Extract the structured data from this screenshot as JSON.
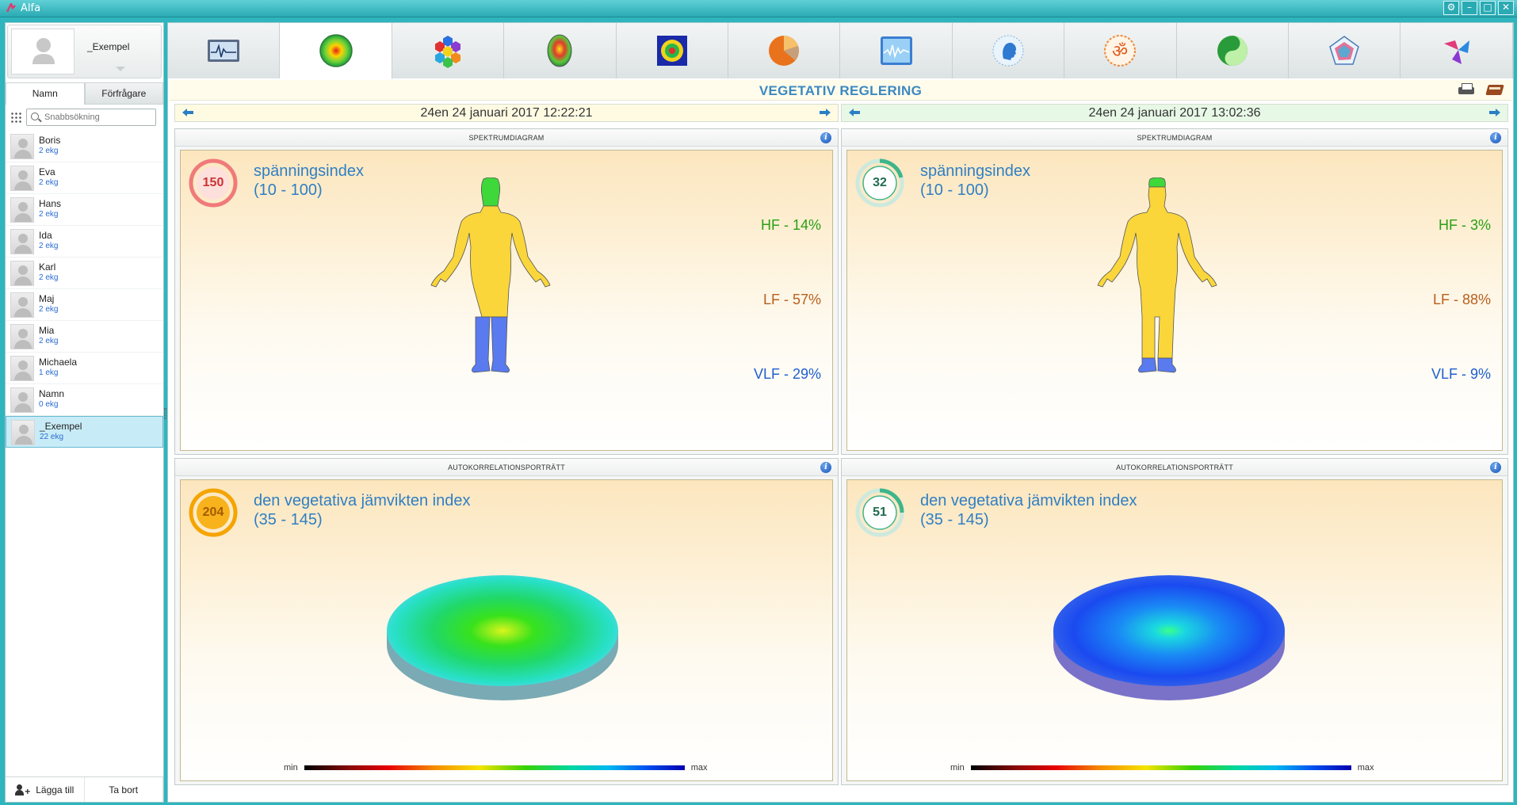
{
  "window": {
    "title": "Alfa"
  },
  "profile": {
    "name": "_Exempel"
  },
  "sidebar": {
    "tabs": [
      "Namn",
      "Förfrågare"
    ],
    "search_placeholder": "Snabbsökning",
    "users": [
      {
        "name": "Boris",
        "count": "2 ekg"
      },
      {
        "name": "Eva",
        "count": "2 ekg"
      },
      {
        "name": "Hans",
        "count": "2 ekg"
      },
      {
        "name": "Ida",
        "count": "2 ekg"
      },
      {
        "name": "Karl",
        "count": "2 ekg"
      },
      {
        "name": "Maj",
        "count": "2 ekg"
      },
      {
        "name": "Mia",
        "count": "2 ekg"
      },
      {
        "name": "Michaela",
        "count": "1 ekg"
      },
      {
        "name": "Namn",
        "count": "0 ekg"
      },
      {
        "name": "_Exempel",
        "count": "22 ekg"
      }
    ],
    "add_label": "Lägga till",
    "remove_label": "Ta bort"
  },
  "toolbar": {
    "icons": [
      "ecg-monitor-icon",
      "spectrum-circle-icon",
      "hexagon-cluster-icon",
      "brain-map-icon",
      "mandala-icon",
      "pie-chart-icon",
      "waveform-icon",
      "head-profile-icon",
      "om-symbol-icon",
      "yin-yang-icon",
      "pentagon-radar-icon",
      "molecule-icon"
    ],
    "active_index": 1
  },
  "header": {
    "title": "VEGETATIV REGLERING"
  },
  "left": {
    "date": "24en 24 januari 2017 12:22:21",
    "spectrum": {
      "panel_title": "SPEKTRUMDIAGRAM",
      "index_value": "150",
      "index_label": "spänningsindex",
      "index_range": "(10 - 100)",
      "gauge_color": "#f07a7a",
      "hf": "HF - 14%",
      "lf": "LF - 57%",
      "vlf": "VLF - 29%"
    },
    "autocorr": {
      "panel_title": "AUTOKORRELATIONSPORTRÄTT",
      "index_value": "204",
      "index_label": "den vegetativa jämvikten index",
      "index_range": "(35 - 145)",
      "gauge_color": "#f5a400",
      "scale_min": "min",
      "scale_max": "max"
    }
  },
  "right": {
    "date": "24en 24 januari 2017 13:02:36",
    "spectrum": {
      "panel_title": "SPEKTRUMDIAGRAM",
      "index_value": "32",
      "index_label": "spänningsindex",
      "index_range": "(10 - 100)",
      "gauge_color": "#3fb58b",
      "hf": "HF - 3%",
      "lf": "LF - 88%",
      "vlf": "VLF - 9%"
    },
    "autocorr": {
      "panel_title": "AUTOKORRELATIONSPORTRÄTT",
      "index_value": "51",
      "index_label": "den vegetativa jämvikten index",
      "index_range": "(35 - 145)",
      "gauge_color": "#3fb58b",
      "scale_min": "min",
      "scale_max": "max"
    }
  }
}
